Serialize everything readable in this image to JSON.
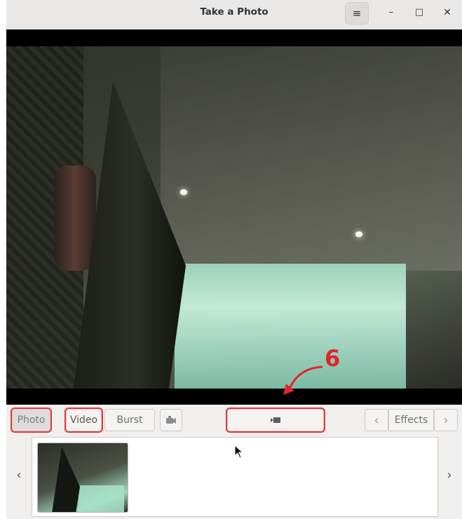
{
  "window": {
    "title": "Take a Photo",
    "menu_icon": "hamburger-menu-icon",
    "controls": {
      "minimize": "–",
      "maximize": "□",
      "close": "✕"
    }
  },
  "annotation": {
    "number": "6",
    "color": "#e0262b"
  },
  "toolbar": {
    "photo_label": "Photo",
    "video_label": "Video",
    "burst_label": "Burst",
    "effects_label": "Effects",
    "prev_symbol": "‹",
    "next_symbol": "›",
    "switch_camera_icon": "camera-switch-icon",
    "record_icon": "video-camera-icon"
  },
  "strip": {
    "left_arrow": "‹",
    "right_arrow": "›",
    "thumbnails": [
      "photo-thumbnail"
    ]
  },
  "colors": {
    "highlight": "#e53935"
  }
}
